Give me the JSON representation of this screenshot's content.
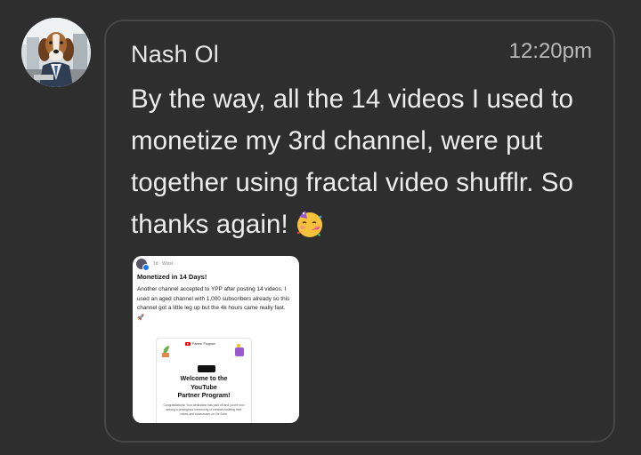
{
  "message": {
    "sender": "Nash Ol",
    "time": "12:20pm",
    "text": "By the way, all the 14 videos I used to monetize my 3rd channel, were put together using fractal video shufflr. So thanks again!",
    "emoji_name": "partying-face-icon"
  },
  "attachment": {
    "post_meta": "1d · Wissl",
    "post_title": "Monetized in 14 Days!",
    "post_body": "Another channel accepted to YPP after posting 14 videos. I used an aged channel with 1,000 subscribers already so this channel got a little leg up but the 4k hours came really fast. 🚀",
    "card_badge": "Partner Program",
    "card_title": "Welcome to the\nYouTube\nPartner Program!",
    "card_subtitle": "Congratulations! Your dedication has paid off and you're now among a prestigious community of creators building their voices and businesses on YouTube."
  },
  "colors": {
    "background": "#2e2e2e",
    "bubble_border": "#474747",
    "text": "#ececec",
    "time": "#b9b9b9"
  }
}
